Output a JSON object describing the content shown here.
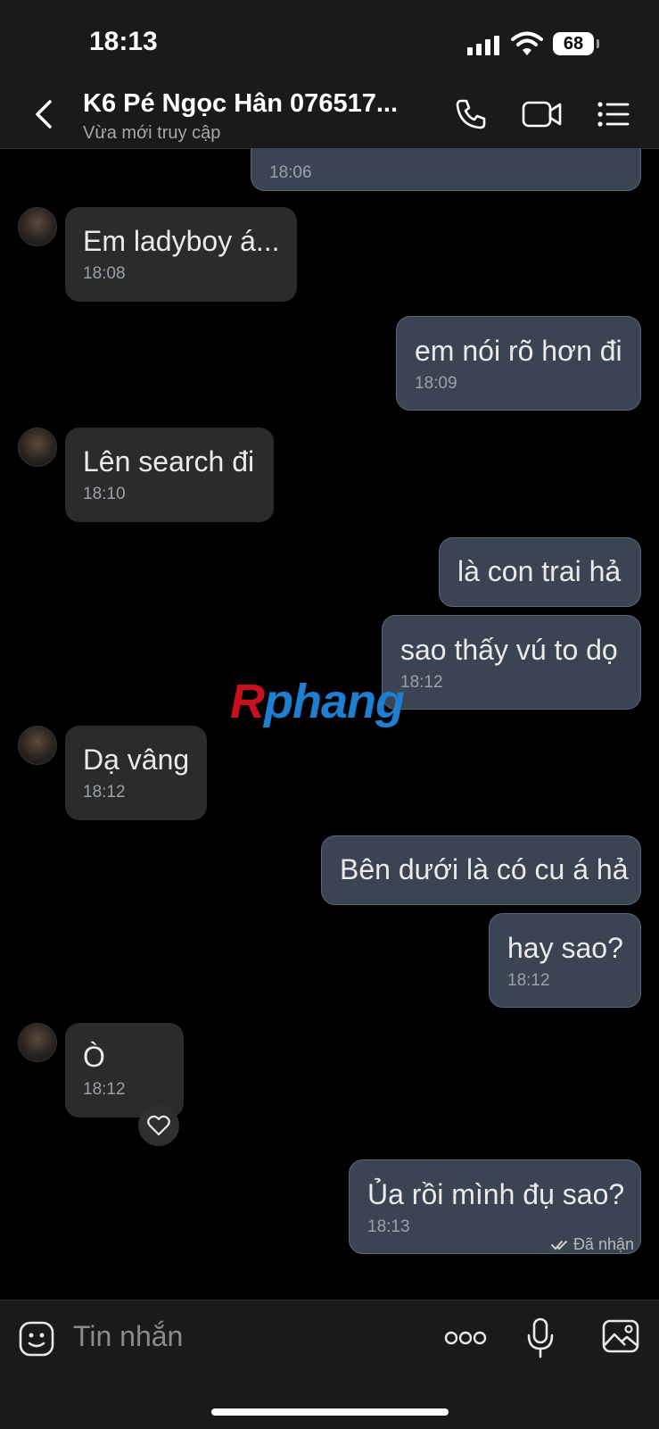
{
  "status": {
    "time": "18:13",
    "battery": "68"
  },
  "header": {
    "title": "K6 Pé Ngọc Hân 076517...",
    "subtitle": "Vừa mới truy cập"
  },
  "messages": [
    {
      "dir": "out",
      "text": "",
      "time": "18:06"
    },
    {
      "dir": "in",
      "text": "Em ladyboy á...",
      "time": "18:08"
    },
    {
      "dir": "out",
      "text": "em nói rõ hơn đi",
      "time": "18:09"
    },
    {
      "dir": "in",
      "text": "Lên search đi",
      "time": "18:10"
    },
    {
      "dir": "out",
      "text": "là con trai hả",
      "time": ""
    },
    {
      "dir": "out",
      "text": "sao thấy vú to dọ",
      "time": "18:12"
    },
    {
      "dir": "in",
      "text": "Dạ vâng",
      "time": "18:12"
    },
    {
      "dir": "out",
      "text": "Bên dưới là có cu á hả",
      "time": ""
    },
    {
      "dir": "out",
      "text": "hay sao?",
      "time": "18:12"
    },
    {
      "dir": "in",
      "text": "Ò",
      "time": "18:12"
    },
    {
      "dir": "out",
      "text": "Ủa rồi mình đụ sao?",
      "time": "18:13"
    }
  ],
  "receipt": "Đã nhận",
  "watermark": {
    "first": "R",
    "rest": "phang"
  },
  "composer": {
    "placeholder": "Tin nhắn"
  },
  "colors": {
    "incoming": "#2b2b2b",
    "outgoing": "#3b4452",
    "background": "#000000"
  }
}
